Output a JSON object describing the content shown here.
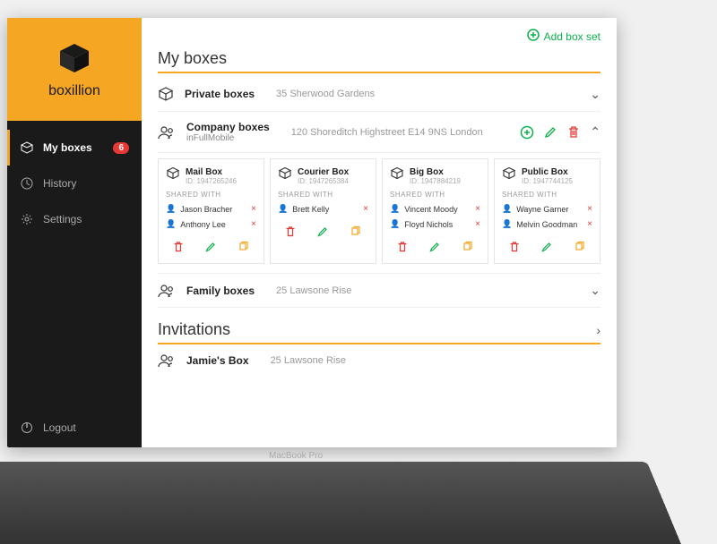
{
  "brand": "boxillion",
  "nav": {
    "my_boxes": "My boxes",
    "badge": "6",
    "history": "History",
    "settings": "Settings",
    "logout": "Logout"
  },
  "add_box_set": "Add box set",
  "section_my_boxes": "My boxes",
  "private_row": {
    "title": "Private boxes",
    "address": "35 Sherwood Gardens"
  },
  "company_row": {
    "title": "Company boxes",
    "sub": "inFullMobile",
    "address": "120 Shoreditch Highstreet E14 9NS London"
  },
  "cards": [
    {
      "title": "Mail Box",
      "id": "ID: 1947265246",
      "shared_label": "SHARED WITH",
      "users": [
        "Jason Bracher",
        "Anthony Lee"
      ]
    },
    {
      "title": "Courier Box",
      "id": "ID: 1947265384",
      "shared_label": "SHARED WITH",
      "users": [
        "Brett Kelly"
      ]
    },
    {
      "title": "Big Box",
      "id": "ID: 1947884219",
      "shared_label": "SHARED WITH",
      "users": [
        "Vincent Moody",
        "Floyd Nichols"
      ]
    },
    {
      "title": "Public Box",
      "id": "ID: 1947744125",
      "shared_label": "SHARED WITH",
      "users": [
        "Wayne Garner",
        "Melvin Goodman"
      ]
    }
  ],
  "family_row": {
    "title": "Family boxes",
    "address": "25 Lawsone Rise"
  },
  "section_invitations": "Invitations",
  "invitation_row": {
    "title": "Jamie's Box",
    "address": "25 Lawsone Rise"
  },
  "laptop_label": "MacBook Pro"
}
